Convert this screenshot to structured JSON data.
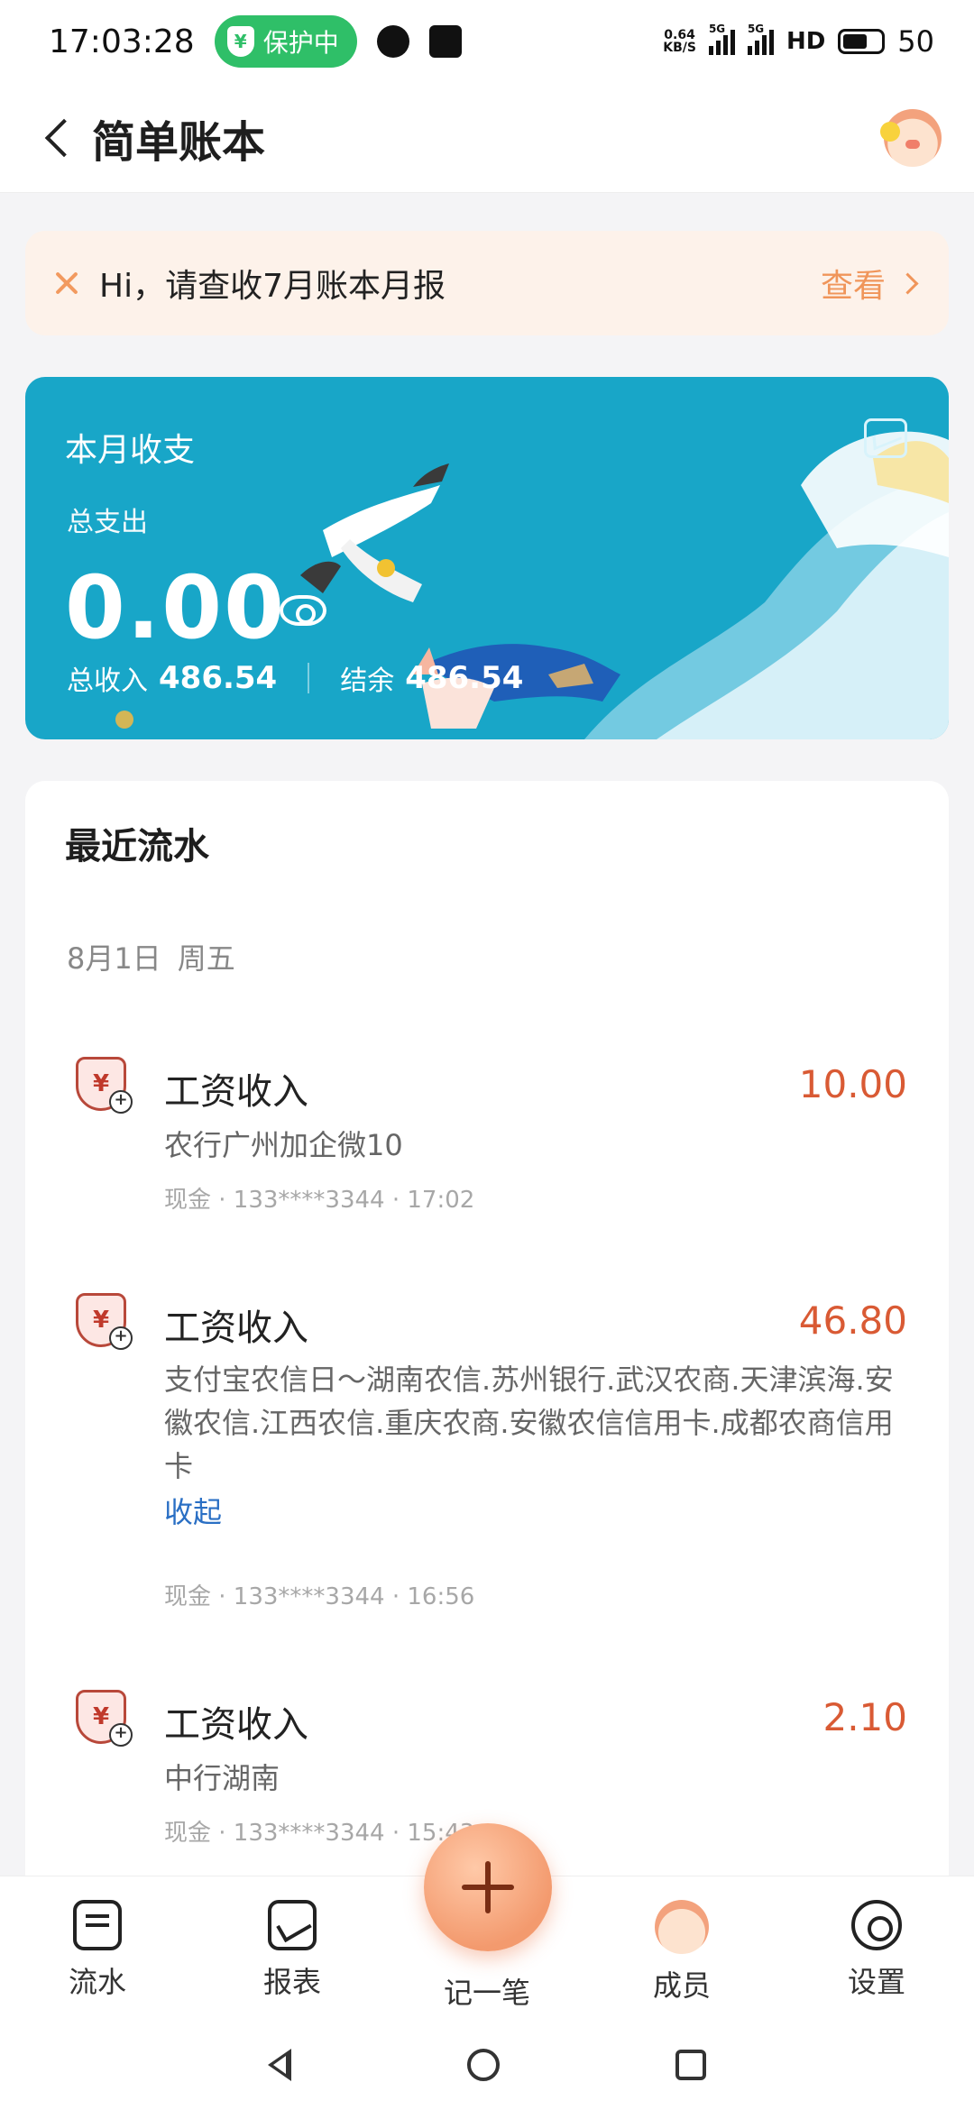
{
  "status_bar": {
    "time": "17:03:28",
    "protect_label": "保护中",
    "net_speed_top": "0.64",
    "net_speed_bottom": "KB/S",
    "network_tag_1": "5G",
    "network_tag_2": "5G",
    "hd_label": "HD",
    "battery_level": "50"
  },
  "header": {
    "title": "简单账本",
    "avatar_icon": "pig-avatar-icon"
  },
  "notice": {
    "text": "Hi，请查收7月账本月报",
    "action_label": "查看"
  },
  "summary": {
    "title": "本月收支",
    "expense_label": "总支出",
    "expense_value": "0.00",
    "income_label": "总收入",
    "income_value": "486.54",
    "balance_label": "结余",
    "balance_value": "486.54",
    "accent_color": "#18a6c8"
  },
  "recent": {
    "title": "最近流水",
    "date": "8月1日",
    "weekday": "周五",
    "entries": [
      {
        "category": "工资收入",
        "amount": "10.00",
        "note": "农行广州加企微10",
        "meta": "现金 · 133****3344 · 17:02"
      },
      {
        "category": "工资收入",
        "amount": "46.80",
        "note": "支付宝农信日～湖南农信.苏州银行.武汉农商.天津滨海.安徽农信.江西农信.重庆农商.安徽农信信用卡.成都农商信用卡",
        "link": "收起",
        "meta": "现金 · 133****3344 · 16:56"
      },
      {
        "category": "工资收入",
        "amount": "2.10",
        "note": "中行湖南",
        "meta": "现金 · 133****3344 · 15:43"
      }
    ],
    "amount_color": "#d95a34"
  },
  "bottom_nav": {
    "items": [
      {
        "label": "流水",
        "icon": "receipt-icon"
      },
      {
        "label": "报表",
        "icon": "report-icon"
      },
      {
        "label": "记一笔",
        "icon": "plus-icon"
      },
      {
        "label": "成员",
        "icon": "member-avatar-icon"
      },
      {
        "label": "设置",
        "icon": "gear-icon"
      }
    ]
  }
}
